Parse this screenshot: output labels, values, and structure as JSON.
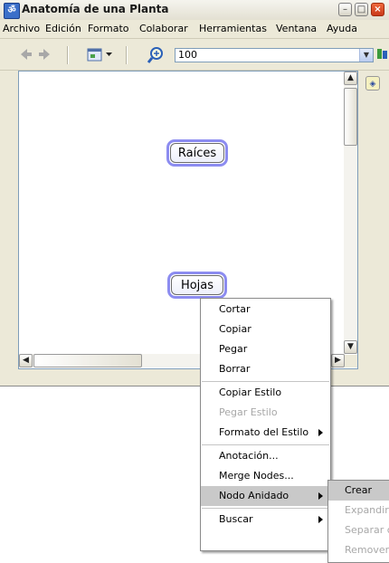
{
  "window": {
    "title": "Anatomía de una Planta",
    "app_icon": "mindmap-app-icon"
  },
  "title_buttons": {
    "minimize": "–",
    "maximize": "□",
    "close": "×"
  },
  "menubar": [
    "Archivo",
    "Edición",
    "Formato",
    "Colaborar",
    "Herramientas",
    "Ventana",
    "Ayuda"
  ],
  "toolbar": {
    "icons": [
      "back-arrow-icon",
      "forward-arrow-icon",
      "map-view-icon",
      "dropdown-icon",
      "zoom-icon"
    ],
    "zoom_value": "100"
  },
  "nodes": [
    {
      "label": "Raíces"
    },
    {
      "label": "Hojas"
    }
  ],
  "context_menu": {
    "items": [
      {
        "label": "Cortar",
        "enabled": true
      },
      {
        "label": "Copiar",
        "enabled": true
      },
      {
        "label": "Pegar",
        "enabled": true
      },
      {
        "label": "Borrar",
        "enabled": true
      },
      {
        "label": "Copiar Estilo",
        "enabled": true
      },
      {
        "label": "Pegar Estilo",
        "enabled": false
      },
      {
        "label": "Formato del Estilo",
        "enabled": true,
        "submenu": true
      },
      {
        "label": "Anotación...",
        "enabled": true
      },
      {
        "label": "Merge Nodes...",
        "enabled": true
      },
      {
        "label": "Nodo Anidado",
        "enabled": true,
        "submenu": true,
        "highlighted": true
      },
      {
        "label": "Buscar",
        "enabled": true,
        "submenu": true
      }
    ]
  },
  "submenu": {
    "items": [
      {
        "label": "Crear",
        "enabled": true
      },
      {
        "label": "Expandir",
        "enabled": false
      },
      {
        "label": "Separar c",
        "enabled": false
      },
      {
        "label": "Remover",
        "enabled": false
      }
    ]
  },
  "colors": {
    "node_border": "#8c8cf0",
    "menu_highlight": "#c9c9c9",
    "disabled_text": "#a8a8a8"
  }
}
